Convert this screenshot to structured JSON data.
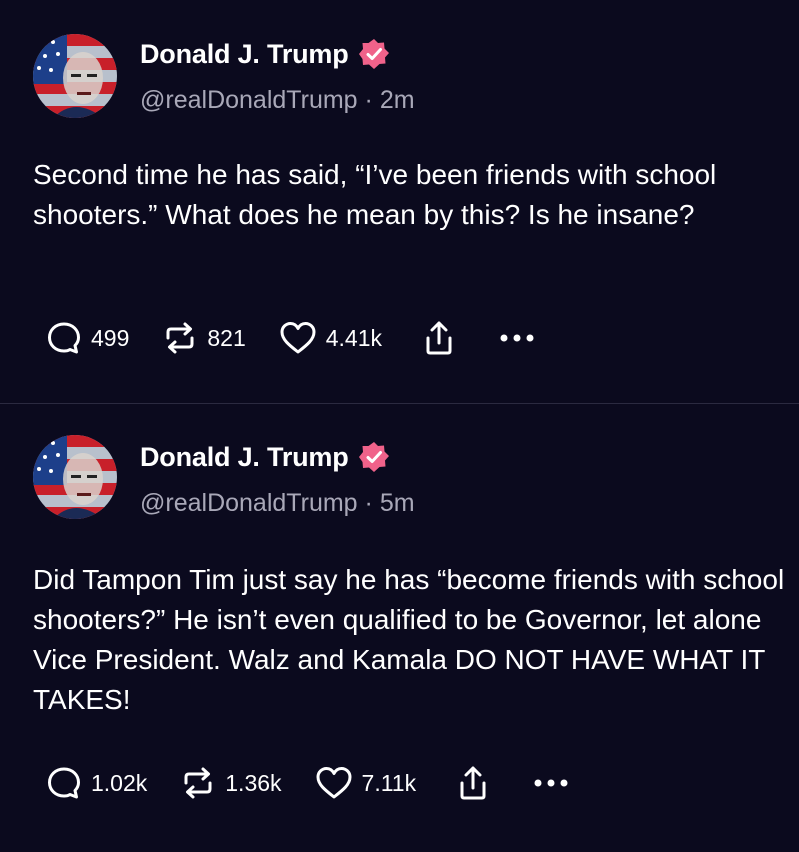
{
  "posts": [
    {
      "author": "Donald J. Trump",
      "handle": "@realDonaldTrump",
      "separator": "·",
      "time": "2m",
      "text": "Second time he has said, “I’ve been friends with school shooters.” What does he mean by this? Is he insane?",
      "replies": "499",
      "reposts": "821",
      "likes": "4.41k"
    },
    {
      "author": "Donald J. Trump",
      "handle": "@realDonaldTrump",
      "separator": "·",
      "time": "5m",
      "text": "Did Tampon Tim just say he has “become friends with school shooters?” He isn’t even qualified to be Governor, let alone Vice President. Walz and Kamala DO NOT HAVE WHAT IT TAKES!",
      "replies": "1.02k",
      "reposts": "1.36k",
      "likes": "7.11k"
    }
  ],
  "icons": {
    "verified": "verified-badge-icon",
    "reply": "reply-icon",
    "repost": "repost-icon",
    "like": "heart-icon",
    "share": "share-icon",
    "more": "more-icon"
  },
  "colors": {
    "background": "#0b0a1e",
    "verified": "#f0628a",
    "text": "#ffffff",
    "muted": "#a9a8b8"
  }
}
